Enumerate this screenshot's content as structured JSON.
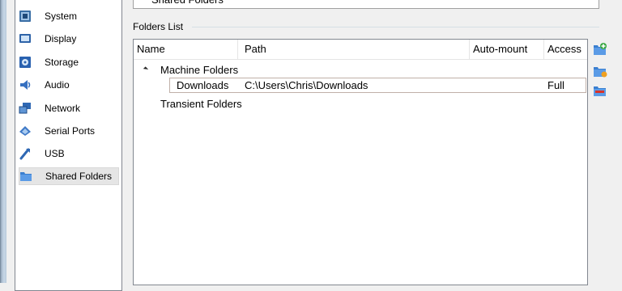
{
  "sidebar": {
    "items": [
      {
        "label": "System",
        "icon": "system-icon"
      },
      {
        "label": "Display",
        "icon": "display-icon"
      },
      {
        "label": "Storage",
        "icon": "storage-icon"
      },
      {
        "label": "Audio",
        "icon": "audio-icon"
      },
      {
        "label": "Network",
        "icon": "network-icon"
      },
      {
        "label": "Serial Ports",
        "icon": "serial-ports-icon"
      },
      {
        "label": "USB",
        "icon": "usb-icon"
      },
      {
        "label": "Shared Folders",
        "icon": "shared-folders-icon",
        "selected": true
      }
    ]
  },
  "page": {
    "title": "Shared Folders"
  },
  "folders_list": {
    "label": "Folders List",
    "columns": [
      "Name",
      "Path",
      "Auto-mount",
      "Access"
    ],
    "groups": [
      {
        "name": "Machine Folders",
        "expanded": true,
        "rows": [
          {
            "name": "Downloads",
            "path": "C:\\Users\\Chris\\Downloads",
            "auto_mount": "",
            "access": "Full"
          }
        ]
      },
      {
        "name": "Transient Folders",
        "expanded": false,
        "rows": []
      }
    ]
  },
  "toolbar": {
    "buttons": [
      {
        "icon": "add-shared-folder-icon"
      },
      {
        "icon": "edit-shared-folder-icon"
      },
      {
        "icon": "remove-shared-folder-icon"
      }
    ]
  },
  "colors": {
    "selection_border": "#c0b0a8",
    "list_border": "#828790",
    "window_bg": "#f0f0f0"
  }
}
